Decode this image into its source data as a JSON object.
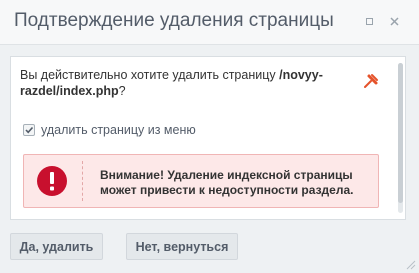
{
  "dialog": {
    "title": "Подтверждение удаления страницы"
  },
  "message": {
    "prefix": "Вы действительно хотите удалить страницу ",
    "path": "/novyy-razdel/index.php",
    "suffix": "?"
  },
  "checkbox": {
    "label": "удалить страницу из меню",
    "checked": true
  },
  "warning": {
    "text": "Внимание! Удаление индексной страницы может привести к недоступности раздела."
  },
  "buttons": {
    "confirm_label": "Да, удалить",
    "cancel_label": "Нет, вернуться"
  },
  "colors": {
    "warning_icon": "#c8102e",
    "pin_icon": "#e5532b"
  },
  "icons": {
    "minimize": "minimize-icon",
    "close": "close-icon",
    "pin": "pin-icon",
    "warning": "warning-icon",
    "check": "check-icon",
    "resize": "resize-grip-icon"
  }
}
